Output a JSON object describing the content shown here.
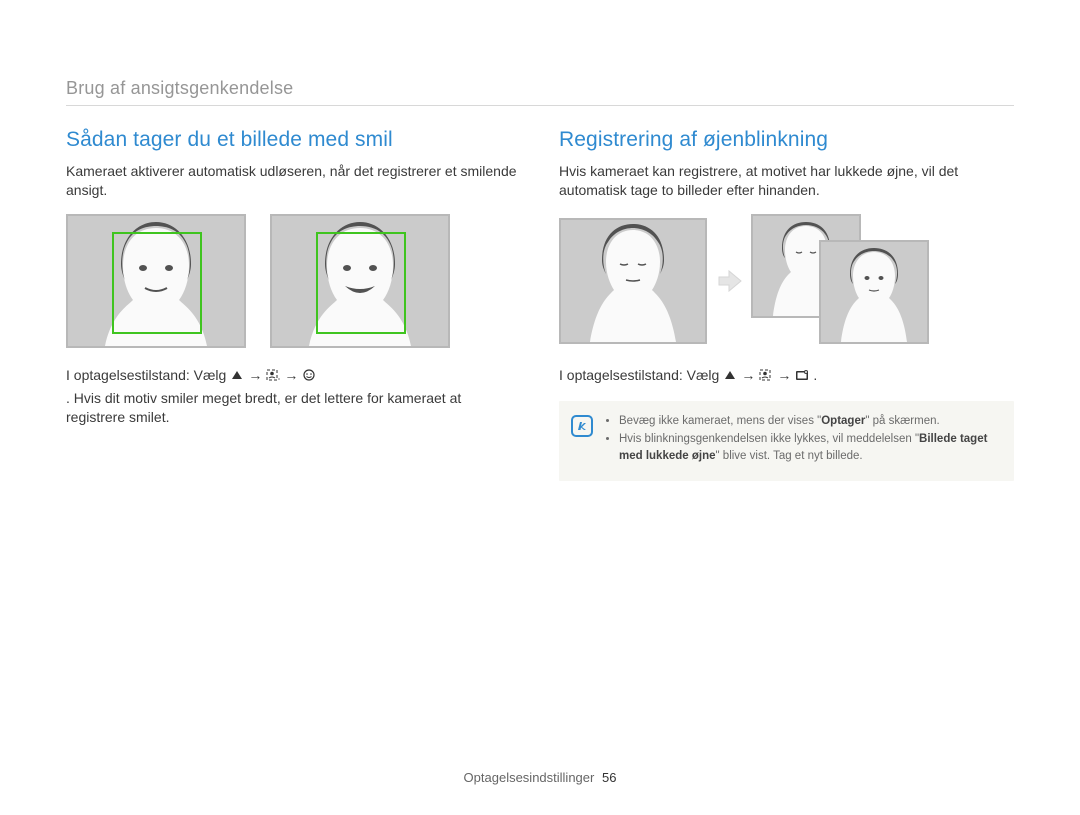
{
  "breadcrumb": "Brug af ansigtsgenkendelse",
  "left": {
    "title": "Sådan tager du et billede med smil",
    "intro": "Kameraet aktiverer automatisk udløseren, når det registrerer et smilende ansigt.",
    "instr_prefix": "I optagelsestilstand: Vælg",
    "instr_suffix": ". Hvis dit motiv smiler meget bredt, er det lettere for kameraet at registrere smilet.",
    "icons": {
      "up": "up-triangle-icon",
      "arrow1": "→",
      "detect": "face-detect-off-icon",
      "arrow2": "→",
      "smile": "smile-icon"
    }
  },
  "right": {
    "title": "Registrering af øjenblinkning",
    "intro": "Hvis kameraet kan registrere, at motivet har lukkede øjne, vil det automatisk tage to billeder efter hinanden.",
    "instr_prefix": "I optagelsestilstand: Vælg",
    "instr_suffix": ".",
    "icons": {
      "up": "up-triangle-icon",
      "arrow1": "→",
      "detect": "face-detect-off-icon",
      "arrow2": "→",
      "blink": "blink-icon"
    },
    "note_item1_a": "Bevæg ikke kameraet, mens der vises \"",
    "note_item1_b": "Optager",
    "note_item1_c": "\" på skærmen.",
    "note_item2_a": "Hvis blinkningsgenkendelsen ikke lykkes, vil meddelelsen \"",
    "note_item2_b": "Billede taget med lukkede øjne",
    "note_item2_c": "\" blive vist. Tag et nyt billede."
  },
  "footer_label": "Optagelsesindstillinger",
  "page_number": "56"
}
